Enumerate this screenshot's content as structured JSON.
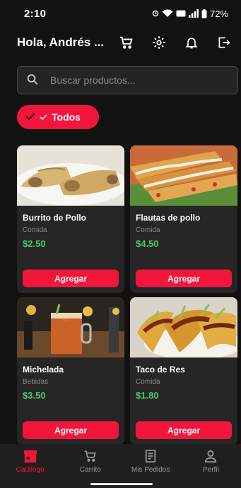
{
  "status_bar": {
    "time": "2:10",
    "battery": "72%"
  },
  "header": {
    "greeting": "Hola, Andrés ...",
    "actions": [
      "cart-icon",
      "gear-icon",
      "bell-icon",
      "logout-icon"
    ]
  },
  "search": {
    "placeholder": "Buscar productos..."
  },
  "filter_chip": {
    "label": "Todos"
  },
  "products": [
    {
      "name": "Burrito de Pollo",
      "category": "Comida",
      "price": "$2.50",
      "button": "Agregar"
    },
    {
      "name": "Flautas de pollo",
      "category": "Comida",
      "price": "$4.50",
      "button": "Agregar"
    },
    {
      "name": "Michelada",
      "category": "Bebidas",
      "price": "$3.50",
      "button": "Agregar"
    },
    {
      "name": "Taco de Res",
      "category": "Comida",
      "price": "$1.80",
      "button": "Agregar"
    }
  ],
  "bottom_nav": [
    {
      "label": "Catálogo",
      "icon": "store-icon",
      "active": true
    },
    {
      "label": "Carrito",
      "icon": "cart-icon",
      "active": false
    },
    {
      "label": "Mis Pedidos",
      "icon": "receipt-icon",
      "active": false
    },
    {
      "label": "Perfil",
      "icon": "person-icon",
      "active": false
    }
  ],
  "colors": {
    "accent": "#f2153c",
    "price": "#4cc766",
    "background": "#121212",
    "card": "#262626"
  }
}
